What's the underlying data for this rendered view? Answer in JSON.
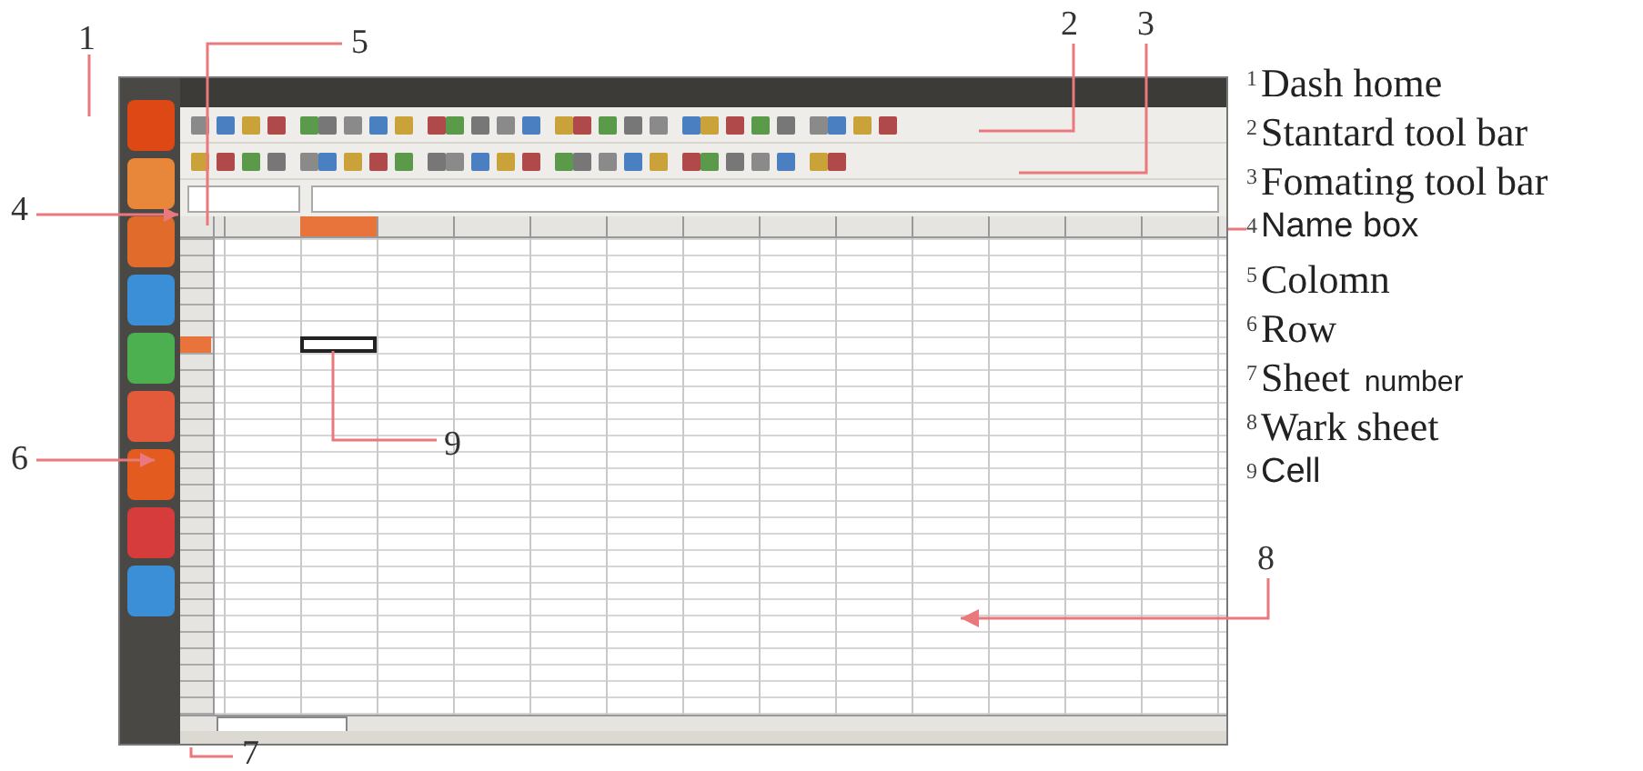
{
  "callouts": [
    {
      "number": "1"
    },
    {
      "number": "5"
    },
    {
      "number": "2"
    },
    {
      "number": "3"
    },
    {
      "number": "4"
    },
    {
      "number": "6"
    },
    {
      "number": "9"
    },
    {
      "number": "8"
    },
    {
      "number": "7"
    }
  ],
  "legend": [
    {
      "number": "1",
      "label": "Dash home",
      "kind": "serif"
    },
    {
      "number": "2",
      "label": "Stantard tool bar",
      "kind": "serif"
    },
    {
      "number": "3",
      "label": "Fomating tool bar",
      "kind": "serif"
    },
    {
      "number": "4",
      "label": "Name box",
      "kind": "sans"
    },
    {
      "number": "5",
      "label": "Colomn",
      "kind": "serif"
    },
    {
      "number": "6",
      "label": "Row",
      "kind": "serif"
    },
    {
      "number": "7",
      "label": "Sheet",
      "note": "number",
      "kind": "serif"
    },
    {
      "number": "8",
      "label": "Wark sheet",
      "kind": "serif"
    },
    {
      "number": "9",
      "label": "Cell",
      "kind": "sans"
    }
  ]
}
